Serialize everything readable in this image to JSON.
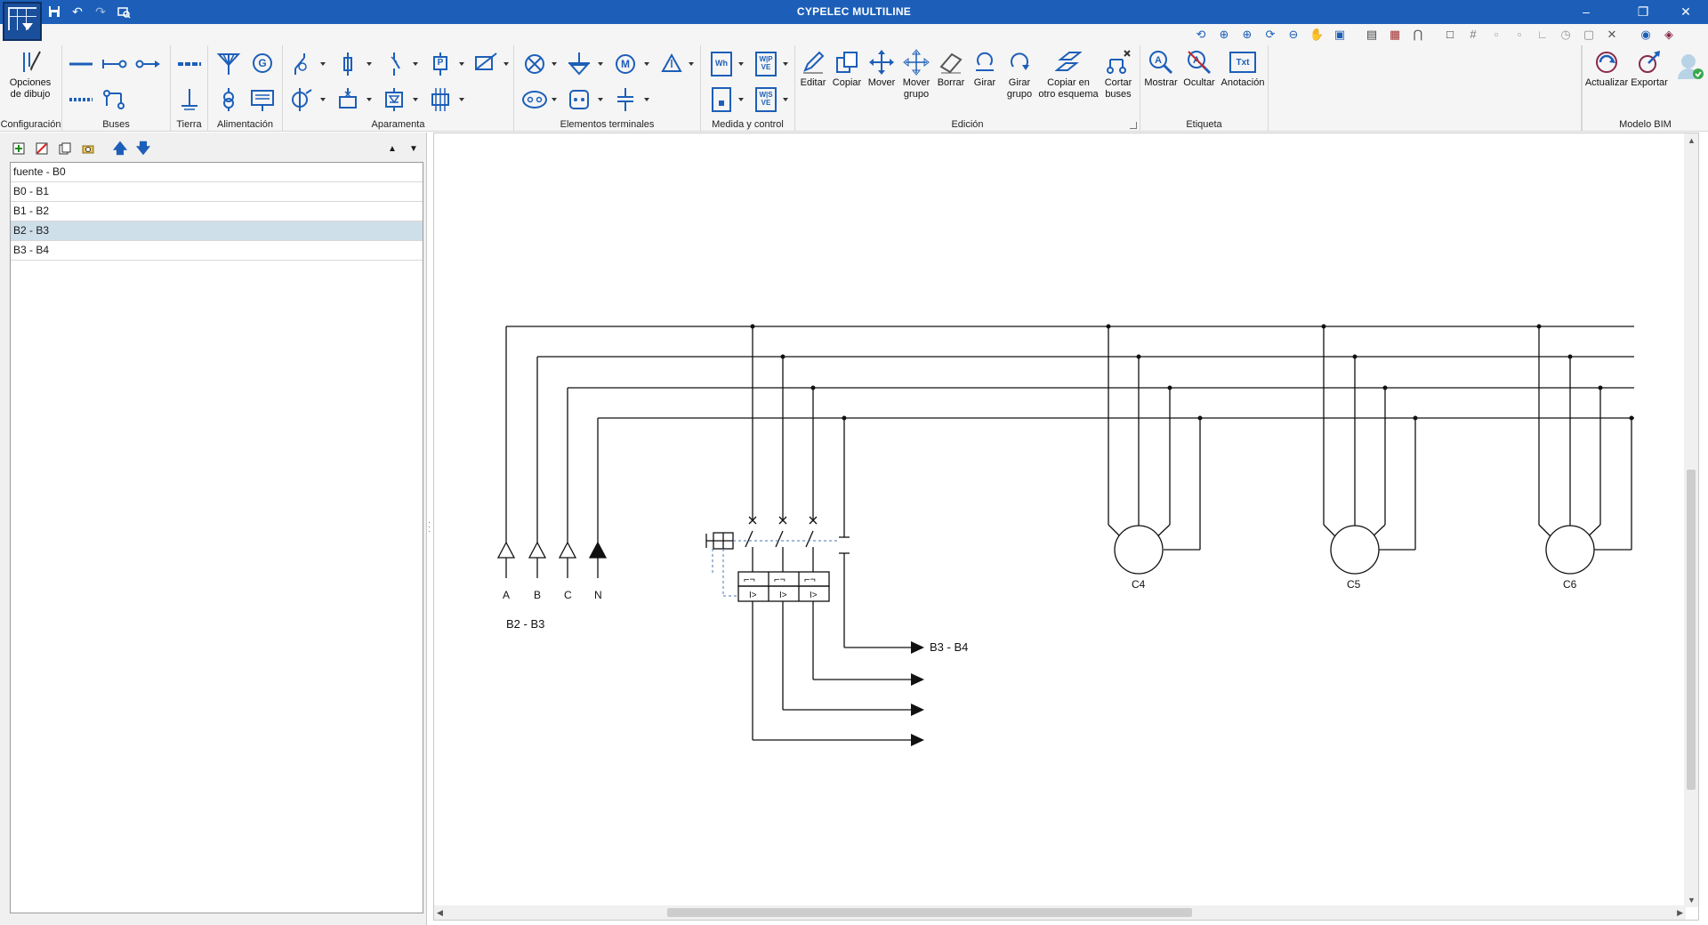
{
  "app": {
    "title": "CYPELEC MULTILINE"
  },
  "quick_access": [
    "save-icon",
    "undo-icon",
    "redo-icon",
    "print-preview-icon"
  ],
  "window_controls": {
    "minimize": "–",
    "restore": "❐",
    "close": "✕"
  },
  "ribbon": {
    "groups": {
      "configuracion": "Configuración",
      "buses": "Buses",
      "tierra": "Tierra",
      "alimentacion": "Alimentación",
      "aparamenta": "Aparamenta",
      "elementos": "Elementos terminales",
      "medida": "Medida y control",
      "edicion": "Edición",
      "etiqueta": "Etiqueta",
      "bim": "Modelo BIM"
    },
    "buttons": {
      "opciones_l1": "Opciones",
      "opciones_l2": "de dibujo",
      "editar": "Editar",
      "copiar": "Copiar",
      "mover": "Mover",
      "mover_grupo_l1": "Mover",
      "mover_grupo_l2": "grupo",
      "borrar": "Borrar",
      "girar": "Girar",
      "girar_grupo_l1": "Girar",
      "girar_grupo_l2": "grupo",
      "copiar_esquema_l1": "Copiar en",
      "copiar_esquema_l2": "otro esquema",
      "cortar_buses_l1": "Cortar",
      "cortar_buses_l2": "buses",
      "mostrar": "Mostrar",
      "ocultar": "Ocultar",
      "anotacion": "Anotación",
      "anotacion_icon_text": "Txt",
      "actualizar": "Actualizar",
      "exportar": "Exportar"
    },
    "icon_labels": {
      "generator": "G",
      "motor": "M",
      "wattmeter": "Wh",
      "meter_a_l1": "W|P",
      "meter_a_l2": "VE",
      "meter_b_l1": "W|S",
      "meter_b_l2": "VE",
      "power_supply": "P"
    }
  },
  "panel": {
    "items": [
      "fuente - B0",
      "B0 - B1",
      "B1 - B2",
      "B2 - B3",
      "B3 - B4"
    ],
    "selected_index": 3
  },
  "schematic": {
    "phase_labels": [
      "A",
      "B",
      "C",
      "N"
    ],
    "group_label": "B2 - B3",
    "outgoing_label": "B3 - B4",
    "motor_labels": [
      "C4",
      "C5",
      "C6"
    ]
  },
  "colors": {
    "title_bar": "#1d5fb8",
    "selection": "#cfdfea",
    "icon_blue": "#1d5fb8"
  }
}
